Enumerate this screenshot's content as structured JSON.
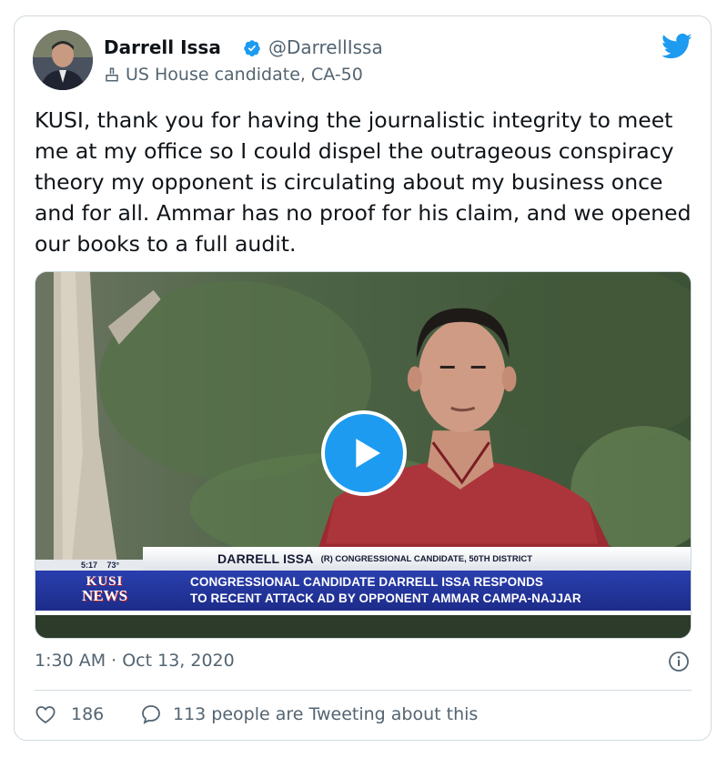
{
  "author": {
    "name": "Darrell Issa",
    "handle": "@DarrellIssa",
    "label": "US House candidate, CA-50"
  },
  "tweet": {
    "text": "KUSI, thank you for having the journalistic integrity to meet me at my office so I could dispel the outrageous conspiracy theory my opponent is circulating about my business once and for all. Ammar has no proof for his claim, and we opened our books to a full audit.",
    "timestamp": "1:30 AM · Oct 13, 2020"
  },
  "video": {
    "time": "5:17",
    "temp": "73°",
    "chyron_name": "DARRELL ISSA",
    "chyron_sub": "(R) CONGRESSIONAL CANDIDATE, 50TH DISTRICT",
    "logo_top": "KUSI",
    "logo_bottom": "NEWS",
    "headline_line1": "CONGRESSIONAL CANDIDATE DARRELL ISSA RESPONDS",
    "headline_line2": "TO RECENT ATTACK AD BY OPPONENT AMMAR CAMPA-NAJJAR"
  },
  "engagement": {
    "likes": "186",
    "replies_text": "113 people are Tweeting about this"
  },
  "colors": {
    "accent": "#1d9bf0",
    "secondary_text": "#536471",
    "border": "#cfd9de"
  },
  "icons": {
    "verified": "verified-badge-icon",
    "label": "ballot-box-icon",
    "brand": "twitter-bird-icon",
    "play": "play-icon",
    "info": "info-icon",
    "like": "heart-icon",
    "reply": "speech-bubble-icon"
  }
}
